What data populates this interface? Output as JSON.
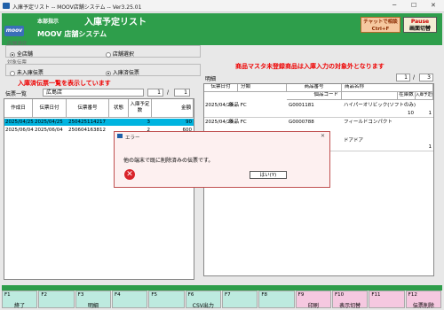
{
  "window": {
    "title": "入庫予定リスト -- MOOV店舗システム -- Ver3.25.01",
    "minimize": "─",
    "maximize": "☐",
    "close": "✕"
  },
  "header": {
    "logo": "moov",
    "subtitle": "本部指示",
    "title": "入庫予定リスト",
    "system": "MOOV 店舗システム",
    "chat_line1": "チャットで相談",
    "chat_line2": "Ctrl+F",
    "pause_line1": "Pause",
    "pause_line2": "画面切替"
  },
  "filters": {
    "store_label": "店舗選択",
    "store_options": [
      "全店舗",
      "店舗選択"
    ],
    "store_selected": 0,
    "target_label": "対象伝票",
    "target_options": [
      "未入庫伝票",
      "入庫済伝票"
    ],
    "target_selected": 1
  },
  "messages": {
    "left": "入庫済伝票一覧を表示しています",
    "right": "商品マスタ未登録商品は入庫入力の対象外となります"
  },
  "list": {
    "title": "伝票一覧",
    "store": "広島店",
    "page": "1",
    "slash": "/",
    "total": "1",
    "columns": [
      "作成日",
      "伝票日付",
      "伝票番号",
      "状態",
      "入庫予定数",
      "金額"
    ],
    "rows": [
      [
        "2025/04/25",
        "2025/04/25",
        "250425114217",
        "",
        "3",
        "90"
      ],
      [
        "2025/06/04",
        "2025/06/04",
        "250604163812",
        "",
        "2",
        "600"
      ]
    ]
  },
  "detail": {
    "title": "明細",
    "page": "1",
    "slash": "/",
    "total": "3",
    "columns": [
      "伝票日付",
      "分類",
      "商品番号",
      "商品名称",
      "在庫数",
      "入庫予定数"
    ],
    "sub_column": "個品コード",
    "rows": [
      {
        "date": "2025/04/25",
        "cat": "新品 FC",
        "code": "G0001181",
        "name": "ハイパーオリビック(ソフトのみ)",
        "stock": "10",
        "qty": "1"
      },
      {
        "date": "2025/04/25",
        "cat": "新品 FC",
        "code": "G0000788",
        "name": "フィールドコンパクト",
        "stock": "",
        "qty": ""
      },
      {
        "date": "",
        "cat": "",
        "code": "",
        "name": "ドアドア",
        "stock": "",
        "qty": "1"
      }
    ]
  },
  "dialog": {
    "title": "エラー",
    "message": "他の端末で既に削除済みの伝票です。",
    "ok": "はい(Y)",
    "close": "✕"
  },
  "fkeys": [
    {
      "n": "F1",
      "l": "終了",
      "c": "#bdeadf"
    },
    {
      "n": "F2",
      "l": "",
      "c": "#bdeadf"
    },
    {
      "n": "F3",
      "l": "明細",
      "c": "#bdeadf"
    },
    {
      "n": "F4",
      "l": "",
      "c": "#bdeadf"
    },
    {
      "n": "F5",
      "l": "",
      "c": "#bdeadf"
    },
    {
      "n": "F6",
      "l": "CSV出力",
      "c": "#bdeadf"
    },
    {
      "n": "F7",
      "l": "",
      "c": "#bdeadf"
    },
    {
      "n": "F8",
      "l": "",
      "c": "#bdeadf"
    },
    {
      "n": "F9",
      "l": "印刷",
      "c": "#f5c8e0"
    },
    {
      "n": "F10",
      "l": "表示切替",
      "c": "#f5c8e0"
    },
    {
      "n": "F11",
      "l": "",
      "c": "#f5c8e0"
    },
    {
      "n": "F12",
      "l": "伝票削除",
      "c": "#f5c8e0"
    }
  ]
}
